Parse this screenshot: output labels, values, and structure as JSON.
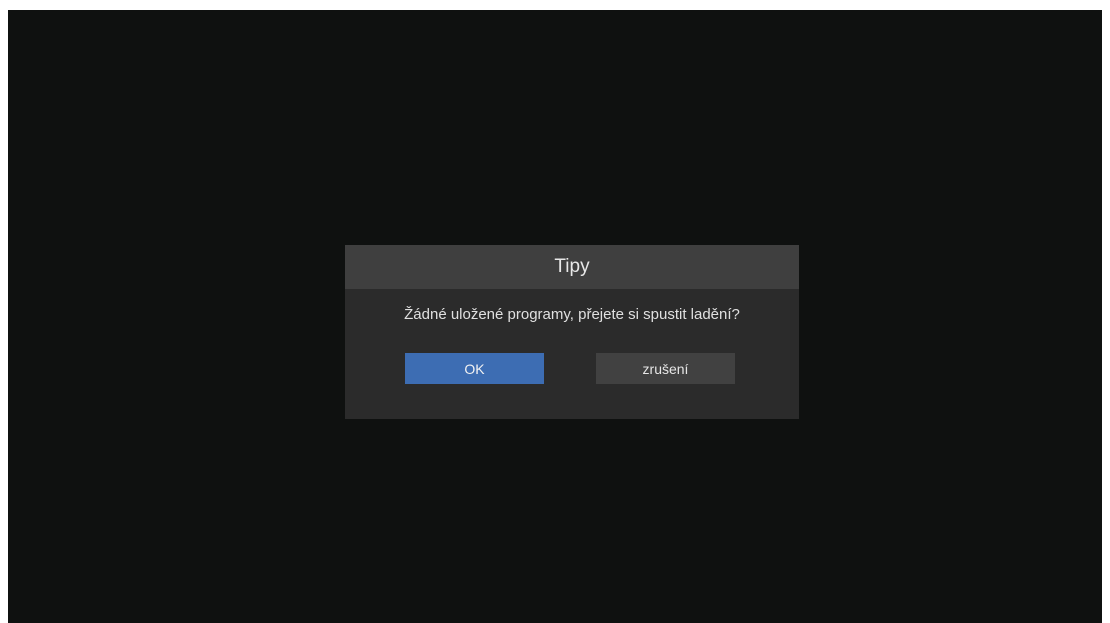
{
  "dialog": {
    "title": "Tipy",
    "message": "Žádné uložené programy, přejete si spustit ladění?",
    "ok_label": "OK",
    "cancel_label": "zrušení"
  },
  "colors": {
    "screen_background": "#0f1110",
    "dialog_background": "#2b2b2b",
    "dialog_header": "#3f3f3f",
    "focused_button": "#3d6db3",
    "unfocused_button": "#414141"
  }
}
